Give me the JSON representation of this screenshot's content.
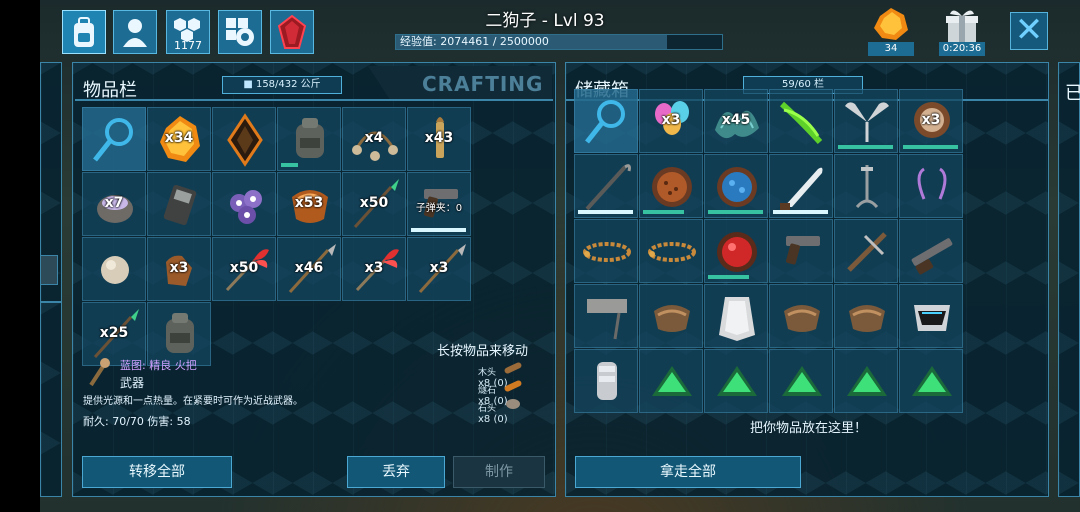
{
  "header": {
    "player_name": "二狗子 - Lvl 93",
    "xp_text": "经验值: 2074461 / 2500000",
    "xp_fraction": 0.83,
    "tribe_count": "1177",
    "embers_count": "34",
    "gift_timer": "0:20:36"
  },
  "icons": {
    "top": [
      "inventory-backpack-icon",
      "character-profile-icon",
      "tribe-hexagon-icon",
      "engrams-gear-icon",
      "tek-crystal-icon"
    ],
    "close": "close-x-icon"
  },
  "colors": {
    "accent": "#1c6c93",
    "panel_border": "#3b86a8",
    "durability": "#37c2a2",
    "text": "#dff3ff"
  },
  "inventory": {
    "title": "物品栏",
    "weight": "158/432 公斤",
    "crafting_tab": "CRAFTING",
    "slots": [
      {
        "icon": "search-magnifier-icon",
        "qty": ""
      },
      {
        "icon": "amber-chunk-icon",
        "qty": "x34"
      },
      {
        "icon": "compass-icon",
        "qty": ""
      },
      {
        "icon": "backpack-sack-icon",
        "qty": "",
        "durability": 0.3
      },
      {
        "icon": "bola-icon",
        "qty": "x4"
      },
      {
        "icon": "rifle-bullet-icon",
        "qty": "x43"
      },
      {
        "icon": "mortar-bowl-icon",
        "qty": "x7"
      },
      {
        "icon": "radio-transmitter-icon",
        "qty": ""
      },
      {
        "icon": "black-pearl-cluster-icon",
        "qty": ""
      },
      {
        "icon": "saddle-icon",
        "qty": "x53"
      },
      {
        "icon": "poison-spear-icon",
        "qty": "x50"
      },
      {
        "icon": "pistol-icon",
        "qty": "子弹夹：0",
        "durability": 0.95,
        "durability_style": "white"
      },
      {
        "icon": "stone-sphere-icon",
        "qty": ""
      },
      {
        "icon": "leather-glove-icon",
        "qty": "x3"
      },
      {
        "icon": "feathered-dart-icon",
        "qty": "x50"
      },
      {
        "icon": "spear-icon",
        "qty": "x46"
      },
      {
        "icon": "feathered-arrow-icon",
        "qty": "x3"
      },
      {
        "icon": "stone-arrow-icon",
        "qty": "x3"
      },
      {
        "icon": "tranq-spear-icon",
        "qty": "x25"
      },
      {
        "icon": "backpack-sack-icon",
        "qty": ""
      }
    ],
    "hint": "长按物品来移动",
    "selected_item": {
      "title": "蓝图: 精良 火把",
      "type": "武器",
      "description": "提供光源和一点热量。在紧要时可作为近战武器。",
      "stats": "耐久: 70/70  伤害: 58",
      "resources": [
        {
          "name": "木头",
          "icon": "wood-log-icon",
          "text": "x8 (0)"
        },
        {
          "name": "燧石",
          "icon": "flint-icon",
          "text": "x8 (0)"
        },
        {
          "name": "石头",
          "icon": "stone-icon",
          "text": "x8 (0)"
        }
      ]
    },
    "buttons": {
      "transfer_all": "转移全部",
      "drop": "丢弃",
      "craft": "制作"
    }
  },
  "storage": {
    "title": "储藏箱",
    "capacity": "59/60 栏",
    "slots": [
      {
        "icon": "search-magnifier-icon",
        "qty": ""
      },
      {
        "icon": "eggs-bundle-icon",
        "qty": "x3"
      },
      {
        "icon": "fiber-pile-icon",
        "qty": "x45"
      },
      {
        "icon": "green-plant-icon",
        "qty": ""
      },
      {
        "icon": "propeller-blades-icon",
        "qty": "",
        "durability": 0.95
      },
      {
        "icon": "wooden-bowl-icon",
        "qty": "x3",
        "durability": 0.95
      },
      {
        "icon": "walking-cane-icon",
        "qty": "",
        "durability": 0.95,
        "durability_style": "white"
      },
      {
        "icon": "red-seed-bowl-icon",
        "qty": "",
        "durability": 0.7
      },
      {
        "icon": "blue-berry-bowl-icon",
        "qty": "",
        "durability": 0.95
      },
      {
        "icon": "machete-icon",
        "qty": "",
        "durability": 0.95,
        "durability_style": "white"
      },
      {
        "icon": "grappling-hook-icon",
        "qty": ""
      },
      {
        "icon": "antenna-icon",
        "qty": ""
      },
      {
        "icon": "chain-bola-icon",
        "qty": ""
      },
      {
        "icon": "chain-bola-icon",
        "qty": ""
      },
      {
        "icon": "red-gem-bowl-icon",
        "qty": "",
        "durability": 0.7
      },
      {
        "icon": "pistol-icon",
        "qty": ""
      },
      {
        "icon": "crossbow-icon",
        "qty": ""
      },
      {
        "icon": "shotgun-icon",
        "qty": ""
      },
      {
        "icon": "stone-sign-icon",
        "qty": ""
      },
      {
        "icon": "leather-saddle-icon",
        "qty": ""
      },
      {
        "icon": "cloth-cape-icon",
        "qty": ""
      },
      {
        "icon": "harness-saddle-icon",
        "qty": ""
      },
      {
        "icon": "leather-saddle-icon",
        "qty": ""
      },
      {
        "icon": "tek-helmet-icon",
        "qty": ""
      },
      {
        "icon": "armor-gauntlet-icon",
        "qty": ""
      },
      {
        "icon": "element-triangle-icon",
        "qty": ""
      },
      {
        "icon": "element-triangle-icon",
        "qty": ""
      },
      {
        "icon": "element-triangle-icon",
        "qty": ""
      },
      {
        "icon": "element-triangle-icon",
        "qty": ""
      },
      {
        "icon": "element-triangle-icon",
        "qty": ""
      }
    ],
    "drop_hint": "把你物品放在这里！",
    "buttons": {
      "take_all": "拿走全部"
    }
  },
  "right_stub": {
    "label": "已"
  }
}
